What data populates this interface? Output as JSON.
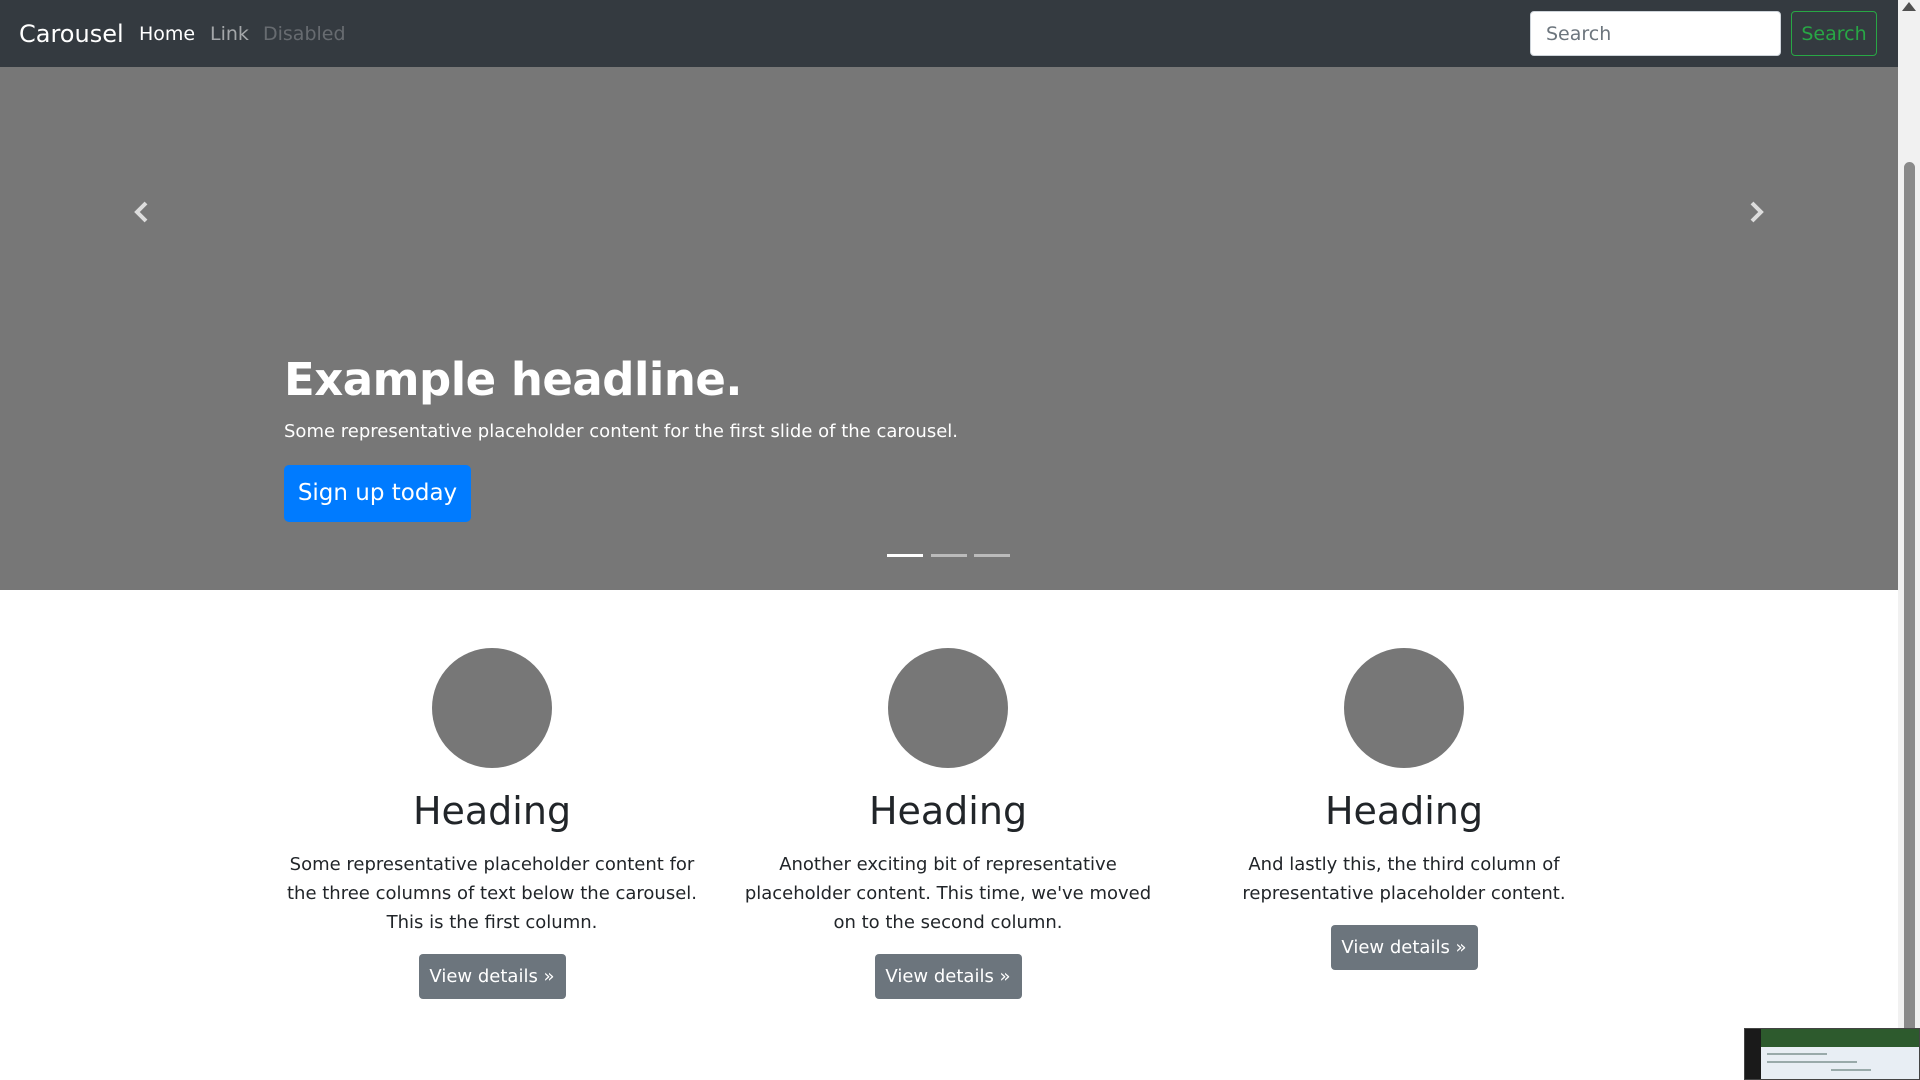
{
  "navbar": {
    "brand": "Carousel",
    "links": [
      {
        "label": "Home",
        "state": "active"
      },
      {
        "label": "Link",
        "state": "normal"
      },
      {
        "label": "Disabled",
        "state": "disabled"
      }
    ],
    "search": {
      "placeholder": "Search",
      "value": "",
      "button_label": "Search"
    }
  },
  "carousel": {
    "active_slide": 1,
    "slide_count": 3,
    "headline": "Example headline.",
    "text": "Some representative placeholder content for the first slide of the carousel.",
    "button_label": "Sign up today",
    "prev_icon": "chevron-left-icon",
    "next_icon": "chevron-right-icon"
  },
  "columns": [
    {
      "heading": "Heading",
      "text": "Some representative placeholder content for the three columns of text below the carousel. This is the first column.",
      "button_label": "View details »"
    },
    {
      "heading": "Heading",
      "text": "Another exciting bit of representative placeholder content. This time, we've moved on to the second column.",
      "button_label": "View details »"
    },
    {
      "heading": "Heading",
      "text": "And lastly this, the third column of representative placeholder content.",
      "button_label": "View details »"
    }
  ],
  "colors": {
    "navbar_bg": "#343a40",
    "carousel_bg": "#777777",
    "primary": "#007bff",
    "success": "#28a745",
    "secondary": "#6c757d"
  }
}
